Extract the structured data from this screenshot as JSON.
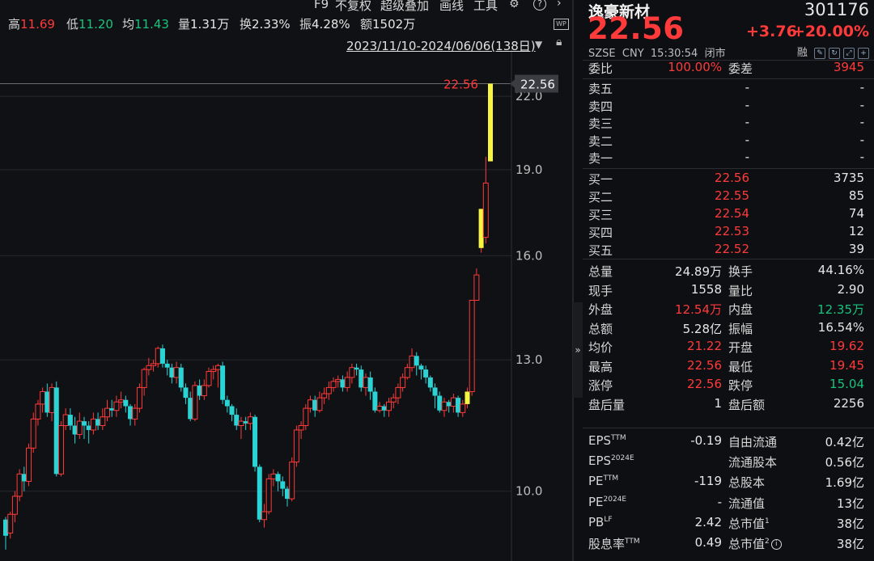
{
  "toolbar": {
    "items": [
      "F9",
      "不复权",
      "超级叠加",
      "画线",
      "工具"
    ],
    "settings_icon": "gear-icon",
    "help_icon": "question-icon",
    "more_icon": "chevron-right-icon",
    "wp_badge": "WP"
  },
  "day_stats": {
    "high_label": "高",
    "high": "11.69",
    "low_label": "低",
    "low": "11.20",
    "avg_label": "均",
    "avg": "11.43",
    "vol_label": "量",
    "vol": "1.31万",
    "turnover_label": "换",
    "turnover": "2.33%",
    "amp_label": "振",
    "amp": "4.28%",
    "amount_label": "额",
    "amount": "1502万"
  },
  "date_range": "2023/11/10-2024/06/06(138日)",
  "price_axis": {
    "ticks": [
      "22.0",
      "19.0",
      "16.0",
      "13.0",
      "10.0"
    ],
    "current_tag": "22.56",
    "current_left_label": "22.56"
  },
  "colors": {
    "up": "#ff3a3a",
    "down": "#2ad4d4",
    "limit_up": "#f5f542",
    "text": "#d7d7d7",
    "green": "#19c37d"
  },
  "chart_data": {
    "type": "candlestick",
    "ylim": [
      8.7,
      24.2
    ],
    "scale": "log",
    "candles": [
      [
        9.45,
        9.15,
        9.5,
        8.9
      ],
      [
        9.2,
        9.55,
        9.6,
        9.1
      ],
      [
        9.55,
        9.9,
        10.0,
        9.4
      ],
      [
        9.9,
        10.35,
        10.45,
        9.8
      ],
      [
        10.35,
        10.2,
        10.5,
        10.0
      ],
      [
        10.2,
        10.9,
        11.0,
        10.1
      ],
      [
        10.9,
        11.55,
        11.7,
        10.8
      ],
      [
        11.55,
        11.9,
        12.0,
        11.4
      ],
      [
        11.9,
        12.2,
        12.3,
        11.7
      ],
      [
        12.2,
        11.7,
        12.4,
        11.6
      ],
      [
        11.7,
        12.3,
        12.4,
        11.5
      ],
      [
        12.3,
        10.35,
        12.45,
        10.3
      ],
      [
        10.35,
        11.4,
        11.5,
        10.3
      ],
      [
        11.4,
        11.65,
        11.8,
        11.3
      ],
      [
        11.65,
        11.4,
        11.8,
        11.3
      ],
      [
        11.4,
        11.2,
        11.6,
        11.0
      ],
      [
        11.2,
        11.5,
        11.7,
        11.1
      ],
      [
        11.5,
        11.4,
        11.6,
        11.1
      ],
      [
        11.4,
        11.3,
        11.5,
        11.0
      ],
      [
        11.3,
        11.55,
        11.7,
        11.2
      ],
      [
        11.55,
        11.4,
        11.7,
        11.3
      ],
      [
        11.4,
        11.6,
        11.8,
        11.3
      ],
      [
        11.6,
        11.8,
        12.0,
        11.5
      ],
      [
        11.8,
        11.75,
        12.0,
        11.6
      ],
      [
        11.75,
        11.95,
        12.1,
        11.6
      ],
      [
        11.95,
        12.0,
        12.2,
        11.8
      ],
      [
        12.0,
        11.85,
        12.1,
        11.7
      ],
      [
        11.85,
        11.55,
        11.9,
        11.4
      ],
      [
        11.55,
        11.8,
        11.9,
        11.4
      ],
      [
        11.8,
        12.3,
        12.4,
        11.7
      ],
      [
        12.3,
        12.75,
        12.8,
        12.1
      ],
      [
        12.75,
        12.85,
        13.05,
        12.6
      ],
      [
        12.85,
        12.9,
        13.0,
        12.7
      ],
      [
        12.9,
        13.3,
        13.35,
        12.8
      ],
      [
        13.3,
        12.9,
        13.4,
        12.8
      ],
      [
        12.9,
        12.8,
        13.0,
        12.6
      ],
      [
        12.8,
        12.55,
        12.9,
        12.4
      ],
      [
        12.55,
        12.8,
        12.95,
        12.4
      ],
      [
        12.8,
        12.3,
        12.9,
        12.2
      ],
      [
        12.3,
        12.05,
        12.4,
        11.9
      ],
      [
        12.05,
        11.55,
        12.2,
        11.5
      ],
      [
        11.55,
        12.35,
        12.45,
        11.5
      ],
      [
        12.35,
        12.1,
        12.5,
        12.0
      ],
      [
        12.1,
        12.35,
        12.5,
        12.0
      ],
      [
        12.35,
        12.7,
        12.8,
        12.3
      ],
      [
        12.7,
        12.75,
        12.85,
        12.5
      ],
      [
        12.75,
        12.85,
        12.9,
        12.3
      ],
      [
        12.85,
        12.0,
        12.95,
        11.9
      ],
      [
        12.0,
        11.85,
        12.1,
        11.7
      ],
      [
        11.85,
        11.65,
        11.9,
        11.5
      ],
      [
        11.65,
        11.4,
        11.8,
        11.3
      ],
      [
        11.4,
        11.5,
        11.6,
        11.1
      ],
      [
        11.5,
        11.45,
        11.6,
        11.3
      ],
      [
        11.45,
        11.6,
        11.7,
        11.3
      ],
      [
        11.6,
        10.5,
        11.65,
        10.4
      ],
      [
        10.5,
        9.45,
        10.55,
        9.4
      ],
      [
        9.45,
        9.6,
        9.75,
        9.3
      ],
      [
        9.6,
        10.25,
        10.35,
        9.55
      ],
      [
        10.25,
        10.35,
        10.45,
        10.1
      ],
      [
        10.35,
        10.2,
        10.4,
        10.0
      ],
      [
        10.2,
        10.05,
        10.3,
        9.9
      ],
      [
        10.05,
        9.85,
        10.1,
        9.7
      ],
      [
        9.85,
        10.6,
        10.7,
        9.8
      ],
      [
        10.6,
        11.3,
        11.4,
        10.5
      ],
      [
        11.3,
        11.4,
        11.5,
        11.1
      ],
      [
        11.4,
        11.8,
        11.9,
        11.3
      ],
      [
        11.8,
        12.0,
        12.1,
        11.7
      ],
      [
        12.0,
        11.75,
        12.1,
        11.6
      ],
      [
        11.75,
        12.05,
        12.2,
        11.7
      ],
      [
        12.05,
        12.15,
        12.3,
        11.9
      ],
      [
        12.15,
        12.3,
        12.45,
        12.0
      ],
      [
        12.3,
        12.45,
        12.55,
        12.2
      ],
      [
        12.45,
        12.5,
        12.6,
        12.3
      ],
      [
        12.5,
        12.3,
        12.6,
        12.2
      ],
      [
        12.3,
        12.55,
        12.7,
        12.2
      ],
      [
        12.55,
        12.8,
        12.9,
        12.4
      ],
      [
        12.8,
        12.75,
        12.9,
        12.6
      ],
      [
        12.75,
        12.3,
        12.85,
        12.2
      ],
      [
        12.3,
        12.55,
        12.65,
        12.1
      ],
      [
        12.55,
        12.2,
        12.7,
        12.0
      ],
      [
        12.2,
        11.75,
        12.3,
        11.7
      ],
      [
        11.75,
        11.85,
        11.95,
        11.7
      ],
      [
        11.85,
        11.75,
        11.9,
        11.6
      ],
      [
        11.75,
        11.95,
        12.05,
        11.6
      ],
      [
        11.95,
        12.05,
        12.15,
        11.8
      ],
      [
        12.05,
        12.3,
        12.4,
        11.9
      ],
      [
        12.3,
        12.55,
        12.65,
        12.2
      ],
      [
        12.55,
        12.8,
        12.9,
        12.5
      ],
      [
        12.8,
        13.1,
        13.3,
        12.7
      ],
      [
        13.1,
        12.85,
        13.2,
        12.6
      ],
      [
        12.85,
        12.75,
        12.9,
        12.5
      ],
      [
        12.75,
        12.55,
        12.85,
        12.4
      ],
      [
        12.55,
        12.3,
        12.6,
        12.2
      ],
      [
        12.3,
        12.1,
        12.4,
        11.8
      ],
      [
        12.1,
        11.75,
        12.2,
        11.7
      ],
      [
        11.75,
        11.95,
        12.05,
        11.6
      ],
      [
        11.95,
        11.85,
        12.0,
        11.7
      ],
      [
        11.85,
        12.05,
        12.15,
        11.7
      ],
      [
        12.05,
        11.7,
        12.1,
        11.6
      ],
      [
        11.7,
        11.9,
        12.0,
        11.6
      ],
      [
        11.9,
        12.2,
        12.3,
        11.8
      ],
      [
        12.2,
        14.64,
        14.64,
        12.1
      ],
      [
        14.64,
        15.4,
        15.6,
        14.9
      ],
      [
        16.25,
        17.57,
        17.57,
        16.1
      ],
      [
        16.6,
        18.5,
        19.5,
        16.4
      ],
      [
        19.32,
        22.56,
        22.56,
        19.32
      ]
    ]
  },
  "quote": {
    "name": "逸豪新材",
    "code": "301176",
    "price": "22.56",
    "change": "+3.76",
    "change_pct": "+20.00%",
    "exchange": "SZSE",
    "currency": "CNY",
    "time": "15:30:54",
    "status": "闭市",
    "margin_label": "融",
    "weibi_label": "委比",
    "weibi": "100.00%",
    "weicha_label": "委差",
    "weicha": "3945",
    "asks": [
      {
        "label": "卖五",
        "price": "-",
        "vol": "-"
      },
      {
        "label": "卖四",
        "price": "-",
        "vol": "-"
      },
      {
        "label": "卖三",
        "price": "-",
        "vol": "-"
      },
      {
        "label": "卖二",
        "price": "-",
        "vol": "-"
      },
      {
        "label": "卖一",
        "price": "-",
        "vol": "-"
      }
    ],
    "bids": [
      {
        "label": "买一",
        "price": "22.56",
        "vol": "3735"
      },
      {
        "label": "买二",
        "price": "22.55",
        "vol": "85"
      },
      {
        "label": "买三",
        "price": "22.54",
        "vol": "74"
      },
      {
        "label": "买四",
        "price": "22.53",
        "vol": "12"
      },
      {
        "label": "买五",
        "price": "22.52",
        "vol": "39"
      }
    ],
    "stats": [
      {
        "l1": "总量",
        "v1": "24.89万",
        "c1": "white",
        "l2": "换手",
        "v2": "44.16%",
        "c2": "white"
      },
      {
        "l1": "现手",
        "v1": "1558",
        "c1": "white",
        "l2": "量比",
        "v2": "2.90",
        "c2": "white"
      },
      {
        "l1": "外盘",
        "v1": "12.54万",
        "c1": "red",
        "l2": "内盘",
        "v2": "12.35万",
        "c2": "green"
      },
      {
        "l1": "总额",
        "v1": "5.28亿",
        "c1": "white",
        "l2": "振幅",
        "v2": "16.54%",
        "c2": "white"
      },
      {
        "l1": "均价",
        "v1": "21.22",
        "c1": "red",
        "l2": "开盘",
        "v2": "19.62",
        "c2": "red"
      },
      {
        "l1": "最高",
        "v1": "22.56",
        "c1": "red",
        "l2": "最低",
        "v2": "19.45",
        "c2": "red"
      },
      {
        "l1": "涨停",
        "v1": "22.56",
        "c1": "red",
        "l2": "跌停",
        "v2": "15.04",
        "c2": "green"
      },
      {
        "l1": "盘后量",
        "v1": "1",
        "c1": "white",
        "l2": "盘后额",
        "v2": "2256",
        "c2": "white"
      }
    ],
    "fundamentals": [
      {
        "l1": "EPS",
        "s1": "TTM",
        "v1": "-0.19",
        "l2": "自由流通",
        "s2": "",
        "v2": "0.42亿"
      },
      {
        "l1": "EPS",
        "s1": "2024E",
        "v1": "",
        "l2": "流通股本",
        "s2": "",
        "v2": "0.56亿"
      },
      {
        "l1": "PE",
        "s1": "TTM",
        "v1": "-119",
        "l2": "总股本",
        "s2": "",
        "v2": "1.69亿"
      },
      {
        "l1": "PE",
        "s1": "2024E",
        "v1": "-",
        "l2": "流通值",
        "s2": "",
        "v2": "13亿"
      },
      {
        "l1": "PB",
        "s1": "LF",
        "v1": "2.42",
        "l2": "总市值",
        "s2": "1",
        "v2": "38亿"
      },
      {
        "l1": "股息率",
        "s1": "TTM",
        "v1": "0.49",
        "l2": "总市值",
        "s2": "2",
        "v2": "38亿"
      }
    ],
    "info_icon": "i"
  },
  "collapse_label": "»"
}
